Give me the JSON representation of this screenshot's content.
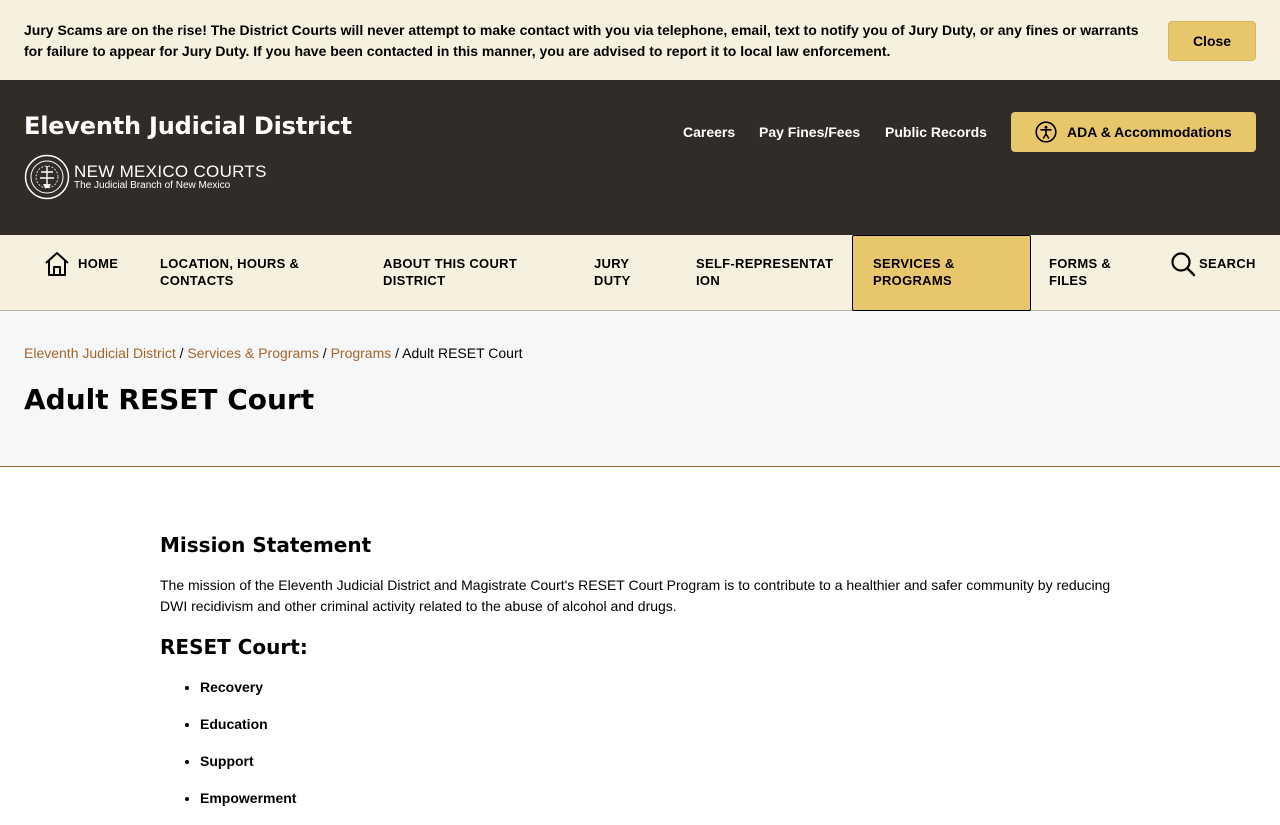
{
  "alert": {
    "message": "Jury Scams are on the rise! The District Courts will never attempt to make contact with you via telephone, email, text to notify you of Jury Duty, or any fines or warrants for failure to appear for Jury Duty. If you have been contacted in this manner, you are advised to report it to local law enforcement.",
    "close_label": "Close"
  },
  "header": {
    "site_title": "Eleventh Judicial District",
    "logo_name": "NEW MEXICO COURTS",
    "logo_tagline": "The Judicial Branch of New Mexico",
    "links": [
      {
        "label": "Careers"
      },
      {
        "label": "Pay Fines/Fees"
      },
      {
        "label": "Public Records"
      }
    ],
    "ada_label": "ADA & Accommodations",
    "accent": "#e8c66b",
    "background": "#322c28"
  },
  "nav": {
    "items": [
      {
        "label": "HOME"
      },
      {
        "label": "LOCATION, HOURS & CONTACTS"
      },
      {
        "label": "ABOUT THIS COURT DISTRICT"
      },
      {
        "label": "JURY DUTY"
      },
      {
        "label": "SELF-REPRESENTATION"
      },
      {
        "label": "SERVICES & PROGRAMS",
        "active": true
      },
      {
        "label": "FORMS & FILES"
      },
      {
        "label": "SEARCH"
      }
    ]
  },
  "breadcrumb": {
    "items": [
      "Eleventh Judicial District",
      "Services & Programs",
      "Programs"
    ],
    "current": "Adult RESET Court",
    "separator": "/"
  },
  "page": {
    "title": "Adult RESET Court"
  },
  "content": {
    "mission_heading": "Mission Statement",
    "mission_text": "The mission of the Eleventh Judicial District and Magistrate Court's RESET Court Program is to contribute to a healthier and safer community by reducing DWI recidivism and other criminal activity related to the abuse of alcohol and drugs.",
    "reset_heading": "RESET Court:",
    "reset_items": [
      "Recovery",
      "Education",
      "Support",
      "Empowerment"
    ]
  }
}
